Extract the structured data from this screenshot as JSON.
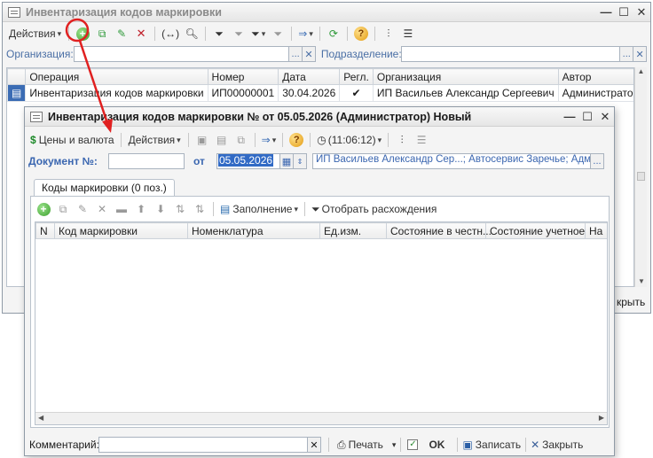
{
  "back_window": {
    "title": "Инвентаризация кодов маркировки",
    "toolbar": {
      "actions_label": "Действия"
    },
    "filter": {
      "org_label": "Организация:",
      "org_value": "",
      "dept_label": "Подразделение:",
      "dept_value": ""
    },
    "columns": [
      "Операция",
      "Номер",
      "Дата",
      "Регл.",
      "Организация",
      "Автор"
    ],
    "rows": [
      {
        "operation": "Инвентаризация кодов маркировки",
        "number": "ИП00000001",
        "date": "30.04.2026",
        "regl": "✔",
        "org": "ИП Васильев Александр Сергеевич",
        "author": "Администратор ..."
      }
    ],
    "close_label_partial": "крыть"
  },
  "front_window": {
    "title": "Инвентаризация кодов маркировки №  от 05.05.2026 (Администратор) Новый",
    "toolbar": {
      "prices_label": "Цены и валюта",
      "actions_label": "Действия",
      "time_label": "(11:06:12)"
    },
    "doc": {
      "number_label": "Документ №:",
      "number_value": "",
      "from_label": "от",
      "date_value": "05.05.2026",
      "org_value": "ИП Васильев Александр Сер...; Автосервис Заречье; Админис..."
    },
    "tab_label": "Коды маркировки (0 поз.)",
    "tab_toolbar": {
      "fill_label": "Заполнение",
      "select_label": "Отобрать расхождения"
    },
    "columns": [
      "N",
      "Код маркировки",
      "Номенклатура",
      "Ед.изм.",
      "Состояние в честн...",
      "Состояние учетное",
      "На"
    ],
    "footer": {
      "comment_label": "Комментарий:",
      "comment_value": "",
      "print_label": "Печать",
      "ok_label": "OK",
      "save_label": "Записать",
      "close_label": "Закрыть"
    }
  },
  "colors": {
    "annotation": "#e02020",
    "link_blue": "#3a66b0",
    "selected_row": "#ffffff",
    "date_highlight": "#316ac5"
  }
}
